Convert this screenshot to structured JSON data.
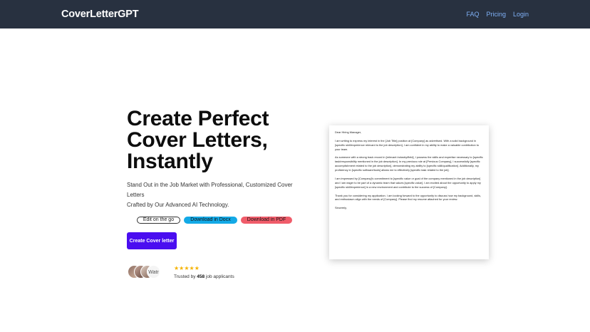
{
  "nav": {
    "brand": "CoverLetterGPT",
    "links": [
      {
        "label": "FAQ"
      },
      {
        "label": "Pricing"
      },
      {
        "label": "Login"
      }
    ]
  },
  "colors": {
    "nav_bg": "#283140",
    "nav_link": "#7fb0f5",
    "cta_bg": "#4a0ef0",
    "docx_pill": "#13a9e6",
    "pdf_pill": "#f05c6a",
    "star": "#f5b301"
  },
  "hero": {
    "title_line1": "Create Perfect",
    "title_line2": "Cover Letters,",
    "title_line3": "Instantly",
    "subtitle_line1": "Stand Out in the Job Market with Professional, Customized Cover Letters",
    "subtitle_line2": "Crafted by Our Advanced AI Technology.",
    "pills": {
      "edit": "Edit on the go",
      "docx": "Download in Docx",
      "pdf": "Download in PDF"
    },
    "cta_label": "Create Cover letter"
  },
  "social_proof": {
    "avatar_overflow_text": "Watr",
    "stars": "★★★★★",
    "trusted_prefix": "Trusted by",
    "trusted_count": "458",
    "trusted_suffix": "job applicants"
  },
  "letter": {
    "greeting": "Dear Hiring Manager,",
    "paragraphs": [
      "I am writing to express my interest in the [Job Title] position at [Company] as advertised. With a solid background in [specific skill/experience relevant to the job description], I am confident in my ability to make a valuable contribution to your team.",
      "As someone with a strong track record in [relevant industry/field], I possess the skills and expertise necessary to [specific task/responsibility mentioned in the job description]. In my previous role at [Previous Company], I successfully [specific accomplishment related to the job description], demonstrating my ability to [specific skill/qualification]. Additionally, my proficiency in [specific software/tools] allows me to effectively [specific task related to the job].",
      "I am impressed by [Company]'s commitment to [specific value or goal of the company mentioned in the job description] and I am eager to be part of a dynamic team that values [specific value]. I am excited about the opportunity to apply my [specific skill/experience] in a new environment and contribute to the success of [Company].",
      "Thank you for considering my application. I am looking forward to the opportunity to discuss how my background, skills, and enthusiasm align with the needs of [Company]. Please find my resume attached for your review."
    ],
    "closing": "Sincerely,"
  }
}
